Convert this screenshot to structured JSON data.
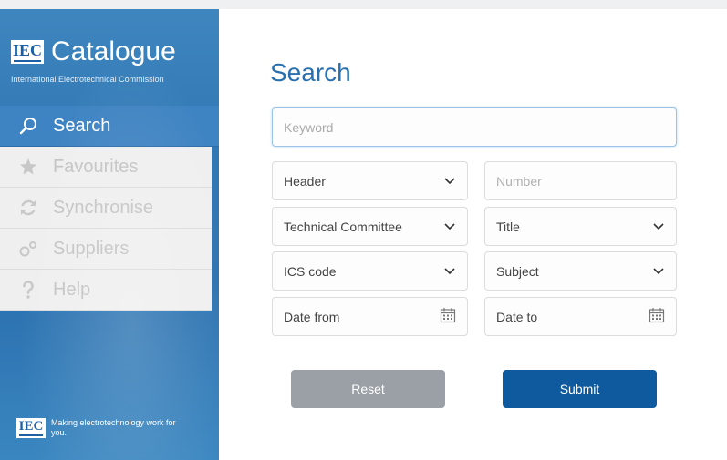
{
  "app": {
    "logo_text": "IEC",
    "title": "Catalogue",
    "subtitle": "International Electrotechnical Commission"
  },
  "nav": {
    "items": [
      {
        "label": "Search",
        "icon": "search-icon",
        "active": true
      },
      {
        "label": "Favourites",
        "icon": "star-icon",
        "active": false
      },
      {
        "label": "Synchronise",
        "icon": "sync-icon",
        "active": false
      },
      {
        "label": "Suppliers",
        "icon": "suppliers-icon",
        "active": false
      },
      {
        "label": "Help",
        "icon": "help-icon",
        "active": false
      }
    ]
  },
  "footer": {
    "logo_text": "IEC",
    "tagline": "Making electrotechnology work for you."
  },
  "search": {
    "title": "Search",
    "keyword_placeholder": "Keyword",
    "header": {
      "value": "Header",
      "icon": "chevron-down-icon"
    },
    "number_placeholder": "Number",
    "technical_committee": {
      "value": "Technical Committee",
      "icon": "chevron-down-icon"
    },
    "title_select": {
      "value": "Title",
      "icon": "chevron-down-icon"
    },
    "ics_code": {
      "value": "ICS code",
      "icon": "chevron-down-icon"
    },
    "subject": {
      "value": "Subject",
      "icon": "chevron-down-icon"
    },
    "date_from": {
      "value": "Date from",
      "icon": "calendar-icon"
    },
    "date_to": {
      "value": "Date to",
      "icon": "calendar-icon"
    },
    "reset_label": "Reset",
    "submit_label": "Submit"
  },
  "colors": {
    "brand_blue": "#2a6fae",
    "active_nav": "#3e83c2",
    "submit": "#0f5a9e",
    "reset": "#9aa0a6"
  }
}
